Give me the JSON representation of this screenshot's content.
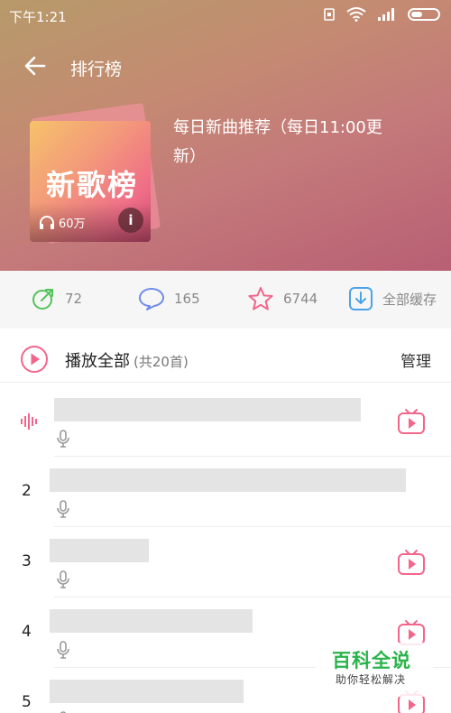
{
  "status_bar": {
    "time": "下午1:21"
  },
  "topbar": {
    "title": "排行榜"
  },
  "playlist": {
    "cover_text": "新歌榜",
    "play_count": "60万",
    "info_label": "i",
    "description": "每日新曲推荐（每日11:00更新）"
  },
  "stats": {
    "shares": "72",
    "comments": "165",
    "favorites": "6744",
    "download_label": "全部缓存"
  },
  "play_all": {
    "label": "播放全部",
    "count": "(共20首)",
    "manage": "管理"
  },
  "tracks": [
    {
      "number": "",
      "now_playing": true,
      "has_mv": true,
      "title_width": 0.68
    },
    {
      "number": "2",
      "now_playing": false,
      "has_mv": false,
      "title_width": 0.79
    },
    {
      "number": "3",
      "now_playing": false,
      "has_mv": true,
      "title_width": 0.22
    },
    {
      "number": "4",
      "now_playing": false,
      "has_mv": true,
      "title_width": 0.45
    },
    {
      "number": "5",
      "now_playing": false,
      "has_mv": true,
      "title_width": 0.43
    }
  ],
  "colors": {
    "accent": "#f2668b",
    "share_green": "#52c45a",
    "comment_blue": "#6f8de8",
    "download_blue": "#4aa3e8"
  },
  "watermark": {
    "title": "百科全说",
    "subtitle": "助你轻松解决"
  }
}
